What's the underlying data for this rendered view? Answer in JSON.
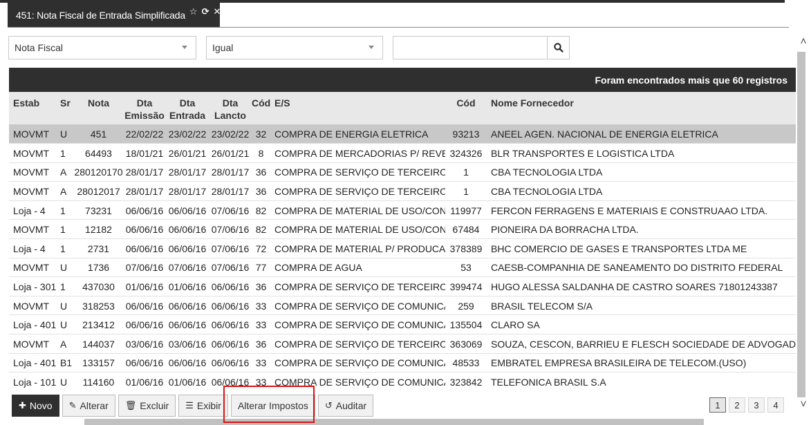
{
  "tab": {
    "title": "451: Nota Fiscal de Entrada Simplificada"
  },
  "filters": {
    "field_value": "Nota Fiscal",
    "operator_value": "Igual",
    "search_value": ""
  },
  "grid": {
    "records_message": "Foram encontrados mais que 60 registros",
    "columns": [
      {
        "line1": "Estab",
        "line2": ""
      },
      {
        "line1": "Sr",
        "line2": ""
      },
      {
        "line1": "Nota",
        "line2": ""
      },
      {
        "line1": "Dta",
        "line2": "Emissão"
      },
      {
        "line1": "Dta",
        "line2": "Entrada"
      },
      {
        "line1": "Dta",
        "line2": "Lancto"
      },
      {
        "line1": "Cód",
        "line2": ""
      },
      {
        "line1": "E/S",
        "line2": ""
      },
      {
        "line1": "Cód",
        "line2": ""
      },
      {
        "line1": "Nome Fornecedor",
        "line2": ""
      }
    ],
    "rows": [
      {
        "estab": "MOVMT",
        "sr": "U",
        "nota": "451",
        "emissao": "22/02/22",
        "entrada": "23/02/22",
        "lancto": "23/02/22",
        "cod": "32",
        "es": "COMPRA DE ENERGIA ELETRICA",
        "cod_forn": "93213",
        "fornecedor": "ANEEL AGEN. NACIONAL DE ENERGIA ELETRICA"
      },
      {
        "estab": "MOVMT",
        "sr": "1",
        "nota": "64493",
        "emissao": "18/01/21",
        "entrada": "26/01/21",
        "lancto": "26/01/21",
        "cod": "8",
        "es": "COMPRA DE MERCADORIAS P/ REVEN",
        "cod_forn": "324326",
        "fornecedor": "BLR TRANSPORTES E LOGISTICA LTDA"
      },
      {
        "estab": "MOVMT",
        "sr": "A",
        "nota": "280120170",
        "emissao": "28/01/17",
        "entrada": "28/01/17",
        "lancto": "28/01/17",
        "cod": "36",
        "es": "COMPRA DE SERVIÇO DE TERCEIROS",
        "cod_forn": "1",
        "fornecedor": "CBA TECNOLOGIA LTDA"
      },
      {
        "estab": "MOVMT",
        "sr": "A",
        "nota": "28012017",
        "emissao": "28/01/17",
        "entrada": "28/01/17",
        "lancto": "28/01/17",
        "cod": "36",
        "es": "COMPRA DE SERVIÇO DE TERCEIROS",
        "cod_forn": "1",
        "fornecedor": "CBA TECNOLOGIA LTDA"
      },
      {
        "estab": "Loja - 4",
        "sr": "1",
        "nota": "73231",
        "emissao": "06/06/16",
        "entrada": "06/06/16",
        "lancto": "07/06/16",
        "cod": "82",
        "es": "COMPRA DE MATERIAL DE USO/CONS",
        "cod_forn": "119977",
        "fornecedor": "FERCON FERRAGENS E MATERIAIS E CONSTRUAAO LTDA."
      },
      {
        "estab": "MOVMT",
        "sr": "1",
        "nota": "12182",
        "emissao": "06/06/16",
        "entrada": "06/06/16",
        "lancto": "07/06/16",
        "cod": "82",
        "es": "COMPRA DE MATERIAL DE USO/CONS",
        "cod_forn": "67484",
        "fornecedor": "PIONEIRA DA BORRACHA LTDA."
      },
      {
        "estab": "Loja - 4",
        "sr": "1",
        "nota": "2731",
        "emissao": "06/06/16",
        "entrada": "06/06/16",
        "lancto": "07/06/16",
        "cod": "72",
        "es": "COMPRA DE MATERIAL P/ PRODUCAO",
        "cod_forn": "378389",
        "fornecedor": "BHC COMERCIO DE GASES E TRANSPORTES LTDA ME"
      },
      {
        "estab": "MOVMT",
        "sr": "U",
        "nota": "1736",
        "emissao": "07/06/16",
        "entrada": "07/06/16",
        "lancto": "07/06/16",
        "cod": "77",
        "es": "COMPRA DE AGUA",
        "cod_forn": "53",
        "fornecedor": "CAESB-COMPANHIA DE SANEAMENTO DO DISTRITO FEDERAL"
      },
      {
        "estab": "Loja - 301",
        "sr": "1",
        "nota": "437030",
        "emissao": "01/06/16",
        "entrada": "01/06/16",
        "lancto": "06/06/16",
        "cod": "36",
        "es": "COMPRA DE SERVIÇO DE TERCEIROS",
        "cod_forn": "399474",
        "fornecedor": "HUGO ALESSA SALDANHA DE CASTRO SOARES 71801243387"
      },
      {
        "estab": "MOVMT",
        "sr": "U",
        "nota": "318253",
        "emissao": "06/06/16",
        "entrada": "06/06/16",
        "lancto": "06/06/16",
        "cod": "33",
        "es": "COMPRA DE SERVIÇO DE COMUNICAÇ",
        "cod_forn": "259",
        "fornecedor": "BRASIL TELECOM S/A"
      },
      {
        "estab": "Loja - 401",
        "sr": "U",
        "nota": "213412",
        "emissao": "06/06/16",
        "entrada": "06/06/16",
        "lancto": "06/06/16",
        "cod": "33",
        "es": "COMPRA DE SERVIÇO DE COMUNICAÇ",
        "cod_forn": "135504",
        "fornecedor": "CLARO SA"
      },
      {
        "estab": "MOVMT",
        "sr": "A",
        "nota": "144037",
        "emissao": "03/06/16",
        "entrada": "03/06/16",
        "lancto": "06/06/16",
        "cod": "36",
        "es": "COMPRA DE SERVIÇO DE TERCEIROS",
        "cod_forn": "363069",
        "fornecedor": "SOUZA, CESCON, BARRIEU E FLESCH SOCIEDADE DE ADVOGADOS"
      },
      {
        "estab": "Loja - 401",
        "sr": "B1",
        "nota": "133157",
        "emissao": "06/06/16",
        "entrada": "06/06/16",
        "lancto": "06/06/16",
        "cod": "33",
        "es": "COMPRA DE SERVIÇO DE COMUNICAÇ",
        "cod_forn": "48533",
        "fornecedor": "EMBRATEL EMPRESA BRASILEIRA DE TELECOM.(USO)"
      },
      {
        "estab": "Loja - 101",
        "sr": "U",
        "nota": "114160",
        "emissao": "01/06/16",
        "entrada": "01/06/16",
        "lancto": "06/06/16",
        "cod": "33",
        "es": "COMPRA DE SERVIÇO DE COMUNICAÇ",
        "cod_forn": "323842",
        "fornecedor": "TELEFONICA BRASIL S.A"
      }
    ]
  },
  "toolbar": {
    "novo": "Novo",
    "alterar": "Alterar",
    "excluir": "Excluir",
    "exibir": "Exibir",
    "alterar_impostos": "Alterar Impostos",
    "auditar": "Auditar"
  },
  "pagination": {
    "pages": [
      "1",
      "2",
      "3",
      "4"
    ],
    "current": "1"
  },
  "colors": {
    "dark": "#2f2f2f",
    "selected_row": "#c8c8c8",
    "highlight": "#e01010"
  }
}
